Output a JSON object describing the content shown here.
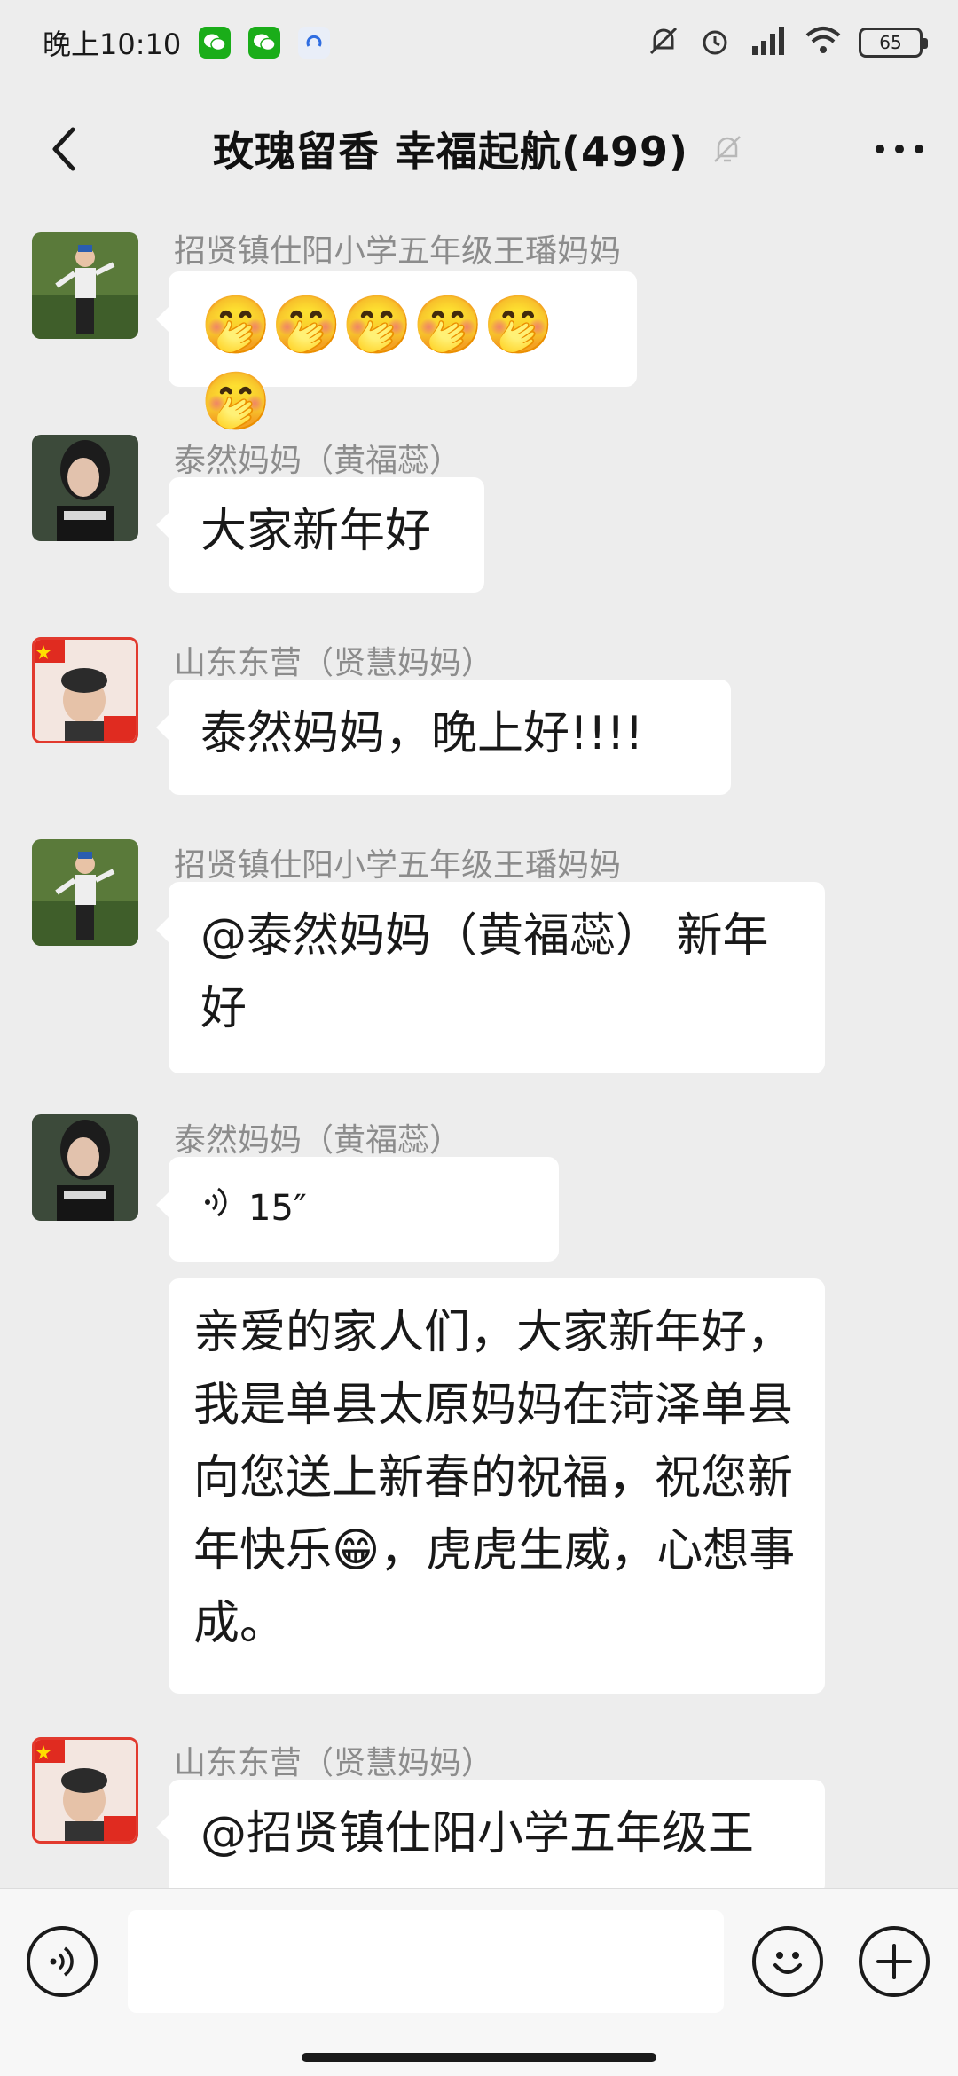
{
  "status_bar": {
    "time": "晚上10:10",
    "battery": "65"
  },
  "header": {
    "title": "玫瑰留香  幸福起航(499)"
  },
  "messages": [
    {
      "sender": "招贤镇仕阳小学五年级王璠妈妈",
      "text": "🤭🤭🤭🤭🤭🤭"
    },
    {
      "sender": "泰然妈妈（黄福蕊）",
      "text": "大家新年好"
    },
    {
      "sender": "山东东营（贤慧妈妈）",
      "text": "泰然妈妈，晚上好!!!!"
    },
    {
      "sender": "招贤镇仕阳小学五年级王璠妈妈",
      "text": "@泰然妈妈（黄福蕊） 新年好"
    },
    {
      "sender": "泰然妈妈（黄福蕊）",
      "voice_duration": "15″",
      "text": "亲爱的家人们，大家新年好，我是单县太原妈妈在菏泽单县向您送上新春的祝福，祝您新年快乐😁，虎虎生威，心想事成。"
    },
    {
      "sender": "山东东营（贤慧妈妈）",
      "text": "@招贤镇仕阳小学五年级王"
    }
  ],
  "colors": {
    "background": "#ededed",
    "bubble": "#ffffff",
    "sender_text": "#8c8c8c",
    "wechat_green": "#1aad19"
  },
  "icons": {
    "back": "chevron-left-icon",
    "mute": "bell-off-icon",
    "more": "more-dots-icon",
    "voice": "voice-icon",
    "emoji": "emoji-icon",
    "plus": "plus-icon"
  }
}
